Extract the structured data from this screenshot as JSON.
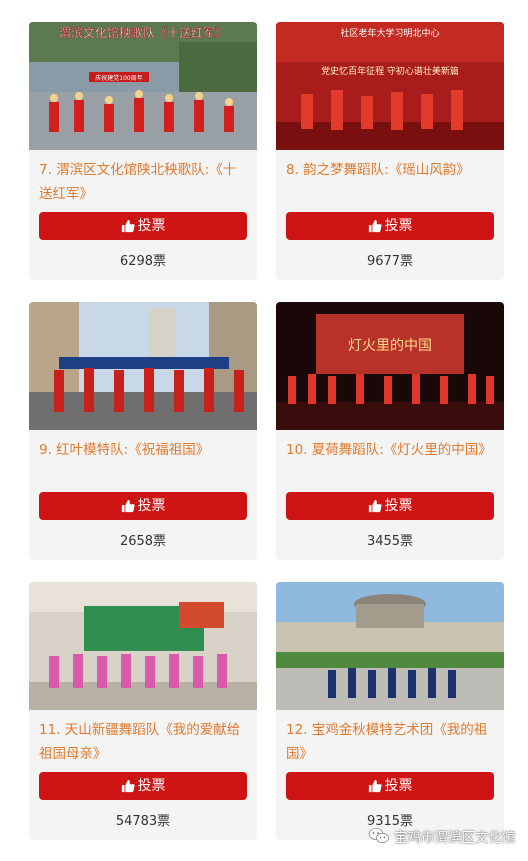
{
  "vote_label": "投票",
  "items": [
    {
      "title": "7. 渭滨区文化馆陕北秧歌队:《十送红军》",
      "count": "6298票",
      "scene": "yangge",
      "overlay_text": "渭滨文化馆秧歌队《十送红军》",
      "banner_text": "庆祝建党100周年"
    },
    {
      "title": "8. 韵之梦舞蹈队:《瑶山风韵》",
      "count": "9677票",
      "scene": "stage-red",
      "overlay_text": "党史忆百年征程 守初心谱壮美新篇",
      "banner_text": "社区老年大学习明北中心"
    },
    {
      "title": "9. 红叶模特队:《祝福祖国》",
      "count": "2658票",
      "scene": "plaza"
    },
    {
      "title": "10. 夏荷舞蹈队:《灯火里的中国》",
      "count": "3455票",
      "scene": "stage-dark",
      "overlay_text": "灯火里的中国"
    },
    {
      "title": "11. 天山新疆舞蹈队《我的爱献给祖国母亲》",
      "count": "54783票",
      "scene": "mall"
    },
    {
      "title": "12. 宝鸡金秋模特艺术团《我的祖国》",
      "count": "9315票",
      "scene": "museum"
    }
  ],
  "watermark": {
    "text": "宝鸡市渭滨区文化馆",
    "icon": "wechat-icon"
  },
  "colors": {
    "title": "#e07a2e",
    "button": "#cf1414",
    "card": "#f4f4f4"
  }
}
